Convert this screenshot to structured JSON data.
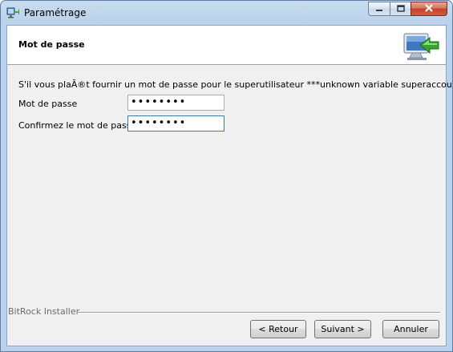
{
  "window": {
    "title": "Paramétrage"
  },
  "header": {
    "title": "Mot de passe"
  },
  "form": {
    "info_text": "S'il vous plaÃ®t fournir un mot de passe pour le superutilisateur ***unknown variable superaccoun***).",
    "password_label": "Mot de passe",
    "password_value": "••••••••",
    "confirm_label": "Confirmez le mot de passe.",
    "confirm_value": "••••••••"
  },
  "footer": {
    "installer_label": "BitRock Installer",
    "back_label": "< Retour",
    "next_label": "Suivant >",
    "cancel_label": "Annuler"
  },
  "icons": {
    "app": "installer-icon",
    "header": "computer-arrow-icon",
    "minimize": "minimize-icon",
    "maximize": "maximize-icon",
    "close": "close-icon"
  }
}
